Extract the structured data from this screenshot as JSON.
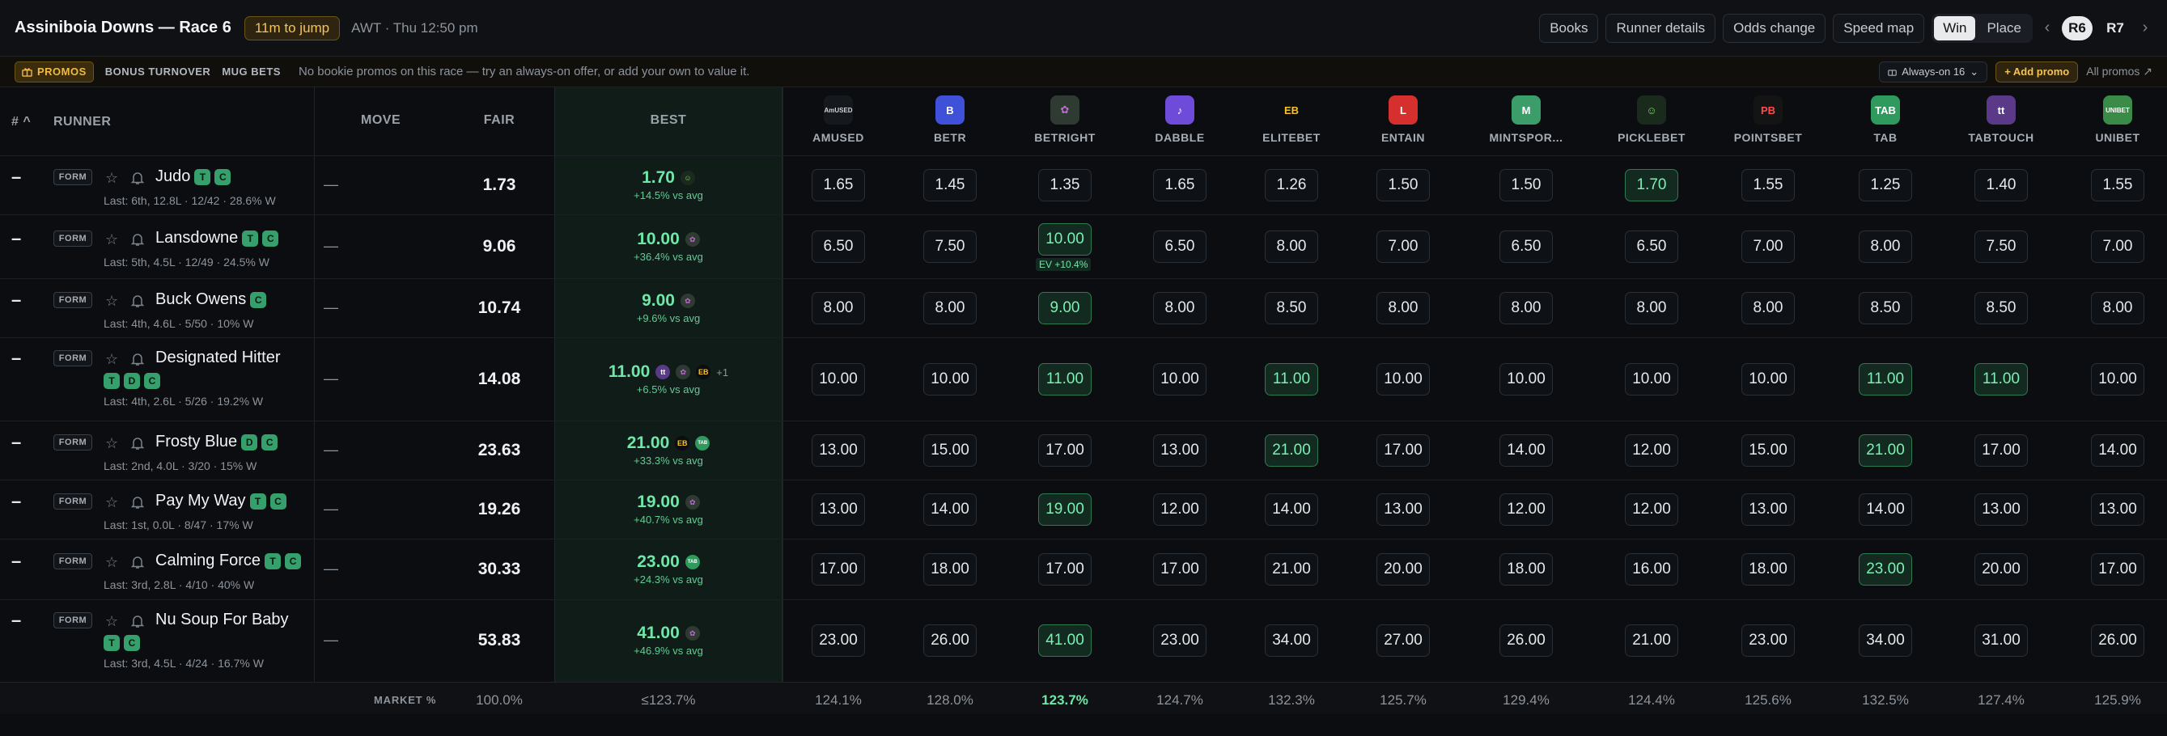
{
  "header": {
    "title": "Assiniboia Downs — Race 6",
    "jump": "11m to jump",
    "meta": "AWT · Thu 12:50 pm",
    "actions": [
      "Books",
      "Runner details",
      "Odds change",
      "Speed map"
    ],
    "market_toggle": [
      "Win",
      "Place"
    ],
    "races": [
      "R6",
      "R7"
    ]
  },
  "promos": {
    "chip": "PROMOS",
    "tabs": [
      "BONUS TURNOVER",
      "MUG BETS"
    ],
    "message": "No bookie promos on this race — try an always-on offer, or add your own to value it.",
    "always_on": "Always-on 16",
    "add": "+ Add promo",
    "all": "All promos"
  },
  "columns": {
    "rank": "#",
    "runner": "RUNNER",
    "move": "MOVE",
    "fair": "FAIR",
    "best": "BEST"
  },
  "books": [
    {
      "name": "AMUSED",
      "logo": "AmUSED",
      "color": "#15181c",
      "text": "#cfd3d7"
    },
    {
      "name": "BETR",
      "logo": "B",
      "color": "#3f51d8",
      "text": "#ffffff"
    },
    {
      "name": "BETRIGHT",
      "logo": "✿",
      "color": "#2f3a32",
      "text": "#c06bd6"
    },
    {
      "name": "DABBLE",
      "logo": "♪",
      "color": "#6e4bd8",
      "text": "#ffffff"
    },
    {
      "name": "ELITEBET",
      "logo": "EB",
      "color": "#0b0d10",
      "text": "#f5c42b"
    },
    {
      "name": "ENTAIN",
      "logo": "L",
      "color": "#d6302e",
      "text": "#ffffff"
    },
    {
      "name": "MINTSPOR...",
      "logo": "M",
      "color": "#3a9d6a",
      "text": "#ffffff"
    },
    {
      "name": "PICKLEBET",
      "logo": "☺",
      "color": "#1a2a1d",
      "text": "#7fd66b"
    },
    {
      "name": "POINTSBET",
      "logo": "PB",
      "color": "#141414",
      "text": "#ff4b4b"
    },
    {
      "name": "TAB",
      "logo": "TAB",
      "color": "#2f9a5d",
      "text": "#ffffff"
    },
    {
      "name": "TABTOUCH",
      "logo": "tt",
      "color": "#5a3a88",
      "text": "#ffffff"
    },
    {
      "name": "UNIBET",
      "logo": "UNIBET",
      "color": "#3a8a48",
      "text": "#ffffff"
    }
  ],
  "runners": [
    {
      "rank": "–",
      "form": "FORM",
      "name": "Judo",
      "tags": [
        "T",
        "C"
      ],
      "tags_wrap": false,
      "sub": "Last: 6th, 12.8L · 12/42 · 28.6% W",
      "move": "—",
      "fair": "1.73",
      "best": "1.70",
      "best_sub": "+14.5% vs avg",
      "best_books": [
        "PICKLEBET"
      ],
      "more": "",
      "odds": [
        "1.65",
        "1.45",
        "1.35",
        "1.65",
        "1.26",
        "1.50",
        "1.50",
        "1.70",
        "1.55",
        "1.25",
        "1.40",
        "1.55"
      ],
      "hi": [
        7
      ],
      "ev": null
    },
    {
      "rank": "–",
      "form": "FORM",
      "name": "Lansdowne",
      "tags": [
        "T",
        "C"
      ],
      "tags_wrap": false,
      "sub": "Last: 5th, 4.5L · 12/49 · 24.5% W",
      "move": "—",
      "fair": "9.06",
      "best": "10.00",
      "best_sub": "+36.4% vs avg",
      "best_books": [
        "BETRIGHT"
      ],
      "more": "",
      "odds": [
        "6.50",
        "7.50",
        "10.00",
        "6.50",
        "8.00",
        "7.00",
        "6.50",
        "6.50",
        "7.00",
        "8.00",
        "7.50",
        "7.00"
      ],
      "hi": [
        2
      ],
      "ev": {
        "book": 2,
        "text": "EV +10.4%"
      }
    },
    {
      "rank": "–",
      "form": "FORM",
      "name": "Buck Owens",
      "tags": [
        "C"
      ],
      "tags_wrap": false,
      "sub": "Last: 4th, 4.6L · 5/50 · 10% W",
      "move": "—",
      "fair": "10.74",
      "best": "9.00",
      "best_sub": "+9.6% vs avg",
      "best_books": [
        "BETRIGHT"
      ],
      "more": "",
      "odds": [
        "8.00",
        "8.00",
        "9.00",
        "8.00",
        "8.50",
        "8.00",
        "8.00",
        "8.00",
        "8.00",
        "8.50",
        "8.50",
        "8.00"
      ],
      "hi": [
        2
      ],
      "ev": null
    },
    {
      "rank": "–",
      "form": "FORM",
      "name": "Designated Hitter",
      "tags": [
        "T",
        "D",
        "C"
      ],
      "tags_wrap": true,
      "sub": "Last: 4th, 2.6L · 5/26 · 19.2% W",
      "move": "—",
      "fair": "14.08",
      "best": "11.00",
      "best_sub": "+6.5% vs avg",
      "best_books": [
        "TABTOUCH",
        "BETRIGHT",
        "ELITEBET"
      ],
      "more": "+1",
      "odds": [
        "10.00",
        "10.00",
        "11.00",
        "10.00",
        "11.00",
        "10.00",
        "10.00",
        "10.00",
        "10.00",
        "11.00",
        "11.00",
        "10.00"
      ],
      "hi": [
        2,
        4,
        9,
        10
      ],
      "ev": null
    },
    {
      "rank": "–",
      "form": "FORM",
      "name": "Frosty Blue",
      "tags": [
        "D",
        "C"
      ],
      "tags_wrap": false,
      "sub": "Last: 2nd, 4.0L · 3/20 · 15% W",
      "move": "—",
      "fair": "23.63",
      "best": "21.00",
      "best_sub": "+33.3% vs avg",
      "best_books": [
        "ELITEBET",
        "TAB"
      ],
      "more": "",
      "odds": [
        "13.00",
        "15.00",
        "17.00",
        "13.00",
        "21.00",
        "17.00",
        "14.00",
        "12.00",
        "15.00",
        "21.00",
        "17.00",
        "14.00"
      ],
      "hi": [
        4,
        9
      ],
      "ev": null
    },
    {
      "rank": "–",
      "form": "FORM",
      "name": "Pay My Way",
      "tags": [
        "T",
        "C"
      ],
      "tags_wrap": false,
      "sub": "Last: 1st, 0.0L · 8/47 · 17% W",
      "move": "—",
      "fair": "19.26",
      "best": "19.00",
      "best_sub": "+40.7% vs avg",
      "best_books": [
        "BETRIGHT"
      ],
      "more": "",
      "odds": [
        "13.00",
        "14.00",
        "19.00",
        "12.00",
        "14.00",
        "13.00",
        "12.00",
        "12.00",
        "13.00",
        "14.00",
        "13.00",
        "13.00"
      ],
      "hi": [
        2
      ],
      "ev": null
    },
    {
      "rank": "–",
      "form": "FORM",
      "name": "Calming Force",
      "tags": [
        "T",
        "C"
      ],
      "tags_wrap": false,
      "sub": "Last: 3rd, 2.8L · 4/10 · 40% W",
      "move": "—",
      "fair": "30.33",
      "best": "23.00",
      "best_sub": "+24.3% vs avg",
      "best_books": [
        "TAB"
      ],
      "more": "",
      "odds": [
        "17.00",
        "18.00",
        "17.00",
        "17.00",
        "21.00",
        "20.00",
        "18.00",
        "16.00",
        "18.00",
        "23.00",
        "20.00",
        "17.00"
      ],
      "hi": [
        9
      ],
      "ev": null
    },
    {
      "rank": "–",
      "form": "FORM",
      "name": "Nu Soup For Baby",
      "tags": [
        "T",
        "C"
      ],
      "tags_wrap": true,
      "sub": "Last: 3rd, 4.5L · 4/24 · 16.7% W",
      "move": "—",
      "fair": "53.83",
      "best": "41.00",
      "best_sub": "+46.9% vs avg",
      "best_books": [
        "BETRIGHT"
      ],
      "more": "",
      "odds": [
        "23.00",
        "26.00",
        "41.00",
        "23.00",
        "34.00",
        "27.00",
        "26.00",
        "21.00",
        "23.00",
        "34.00",
        "31.00",
        "26.00"
      ],
      "hi": [
        2
      ],
      "ev": null
    }
  ],
  "footer": {
    "label": "MARKET %",
    "fair": "100.0%",
    "best": "≤123.7%",
    "books": [
      "124.1%",
      "128.0%",
      "123.7%",
      "124.7%",
      "132.3%",
      "125.7%",
      "129.4%",
      "124.4%",
      "125.6%",
      "132.5%",
      "127.4%",
      "125.9%"
    ],
    "best_book_index": 2
  }
}
